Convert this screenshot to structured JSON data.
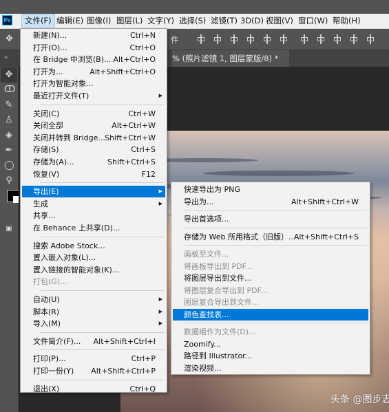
{
  "app": {
    "logo_text": "Ps"
  },
  "menubar": {
    "items": [
      "文件(F)",
      "编辑(E)",
      "图像(I)",
      "图层(L)",
      "文字(Y)",
      "选择(S)",
      "滤镜(T)",
      "3D(D)",
      "视图(V)",
      "窗口(W)",
      "帮助(H)"
    ]
  },
  "options_bar": {
    "text": "件"
  },
  "document_tab": {
    "title": "% (照片滤镜 1, 图层蒙版/8) *"
  },
  "file_menu": {
    "groups": [
      [
        {
          "label": "新建(N)...",
          "shortcut": "Ctrl+N"
        },
        {
          "label": "打开(O)...",
          "shortcut": "Ctrl+O"
        },
        {
          "label": "在 Bridge 中浏览(B)...",
          "shortcut": "Alt+Ctrl+O"
        },
        {
          "label": "打开为...",
          "shortcut": "Alt+Shift+Ctrl+O"
        },
        {
          "label": "打开为智能对象...",
          "shortcut": ""
        },
        {
          "label": "最近打开文件(T)",
          "shortcut": "",
          "submenu": true
        }
      ],
      [
        {
          "label": "关闭(C)",
          "shortcut": "Ctrl+W"
        },
        {
          "label": "关闭全部",
          "shortcut": "Alt+Ctrl+W"
        },
        {
          "label": "关闭并转到 Bridge...",
          "shortcut": "Shift+Ctrl+W"
        },
        {
          "label": "存储(S)",
          "shortcut": "Ctrl+S"
        },
        {
          "label": "存储为(A)...",
          "shortcut": "Shift+Ctrl+S"
        },
        {
          "label": "恢复(V)",
          "shortcut": "F12"
        }
      ],
      [
        {
          "label": "导出(E)",
          "shortcut": "",
          "submenu": true,
          "highlighted": true
        },
        {
          "label": "生成",
          "shortcut": "",
          "submenu": true
        },
        {
          "label": "共享...",
          "shortcut": ""
        },
        {
          "label": "在 Behance 上共享(D)...",
          "shortcut": ""
        }
      ],
      [
        {
          "label": "搜索 Adobe Stock...",
          "shortcut": ""
        },
        {
          "label": "置入嵌入对象(L)...",
          "shortcut": ""
        },
        {
          "label": "置入链接的智能对象(K)...",
          "shortcut": ""
        },
        {
          "label": "打包(G)...",
          "shortcut": "",
          "disabled": true
        }
      ],
      [
        {
          "label": "自动(U)",
          "shortcut": "",
          "submenu": true
        },
        {
          "label": "脚本(R)",
          "shortcut": "",
          "submenu": true
        },
        {
          "label": "导入(M)",
          "shortcut": "",
          "submenu": true
        }
      ],
      [
        {
          "label": "文件简介(F)...",
          "shortcut": "Alt+Shift+Ctrl+I"
        }
      ],
      [
        {
          "label": "打印(P)...",
          "shortcut": "Ctrl+P"
        },
        {
          "label": "打印一份(Y)",
          "shortcut": "Alt+Shift+Ctrl+P"
        }
      ],
      [
        {
          "label": "退出(X)",
          "shortcut": "Ctrl+Q"
        }
      ]
    ]
  },
  "export_submenu": {
    "groups": [
      [
        {
          "label": "快速导出为 PNG",
          "shortcut": ""
        },
        {
          "label": "导出为...",
          "shortcut": "Alt+Shift+Ctrl+W"
        }
      ],
      [
        {
          "label": "导出首选项...",
          "shortcut": ""
        }
      ],
      [
        {
          "label": "存储为 Web 所用格式（旧版）...",
          "shortcut": "Alt+Shift+Ctrl+S"
        }
      ],
      [
        {
          "label": "画板至文件...",
          "shortcut": "",
          "disabled": true
        },
        {
          "label": "将画板导出到 PDF...",
          "shortcut": "",
          "disabled": true
        },
        {
          "label": "将图层导出到文件...",
          "shortcut": ""
        },
        {
          "label": "将图层复合导出到 PDF...",
          "shortcut": "",
          "disabled": true
        },
        {
          "label": "图层复合导出到文件...",
          "shortcut": "",
          "disabled": true
        },
        {
          "label": "颜色查找表...",
          "shortcut": "",
          "highlighted": true
        }
      ],
      [
        {
          "label": "数据组作为文件(D)...",
          "shortcut": "",
          "disabled": true
        },
        {
          "label": "Zoomify...",
          "shortcut": ""
        },
        {
          "label": "路径到 Illustrator...",
          "shortcut": ""
        },
        {
          "label": "渲染视频...",
          "shortcut": ""
        }
      ]
    ]
  },
  "watermark": "头条 @图步志"
}
